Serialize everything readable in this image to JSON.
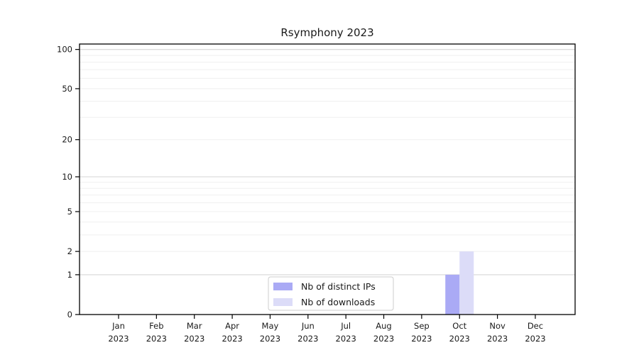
{
  "chart_data": {
    "type": "bar",
    "title": "Rsymphony 2023",
    "categories": [
      "Jan 2023",
      "Feb 2023",
      "Mar 2023",
      "Apr 2023",
      "May 2023",
      "Jun 2023",
      "Jul 2023",
      "Aug 2023",
      "Sep 2023",
      "Oct 2023",
      "Nov 2023",
      "Dec 2023"
    ],
    "series": [
      {
        "name": "Nb of distinct IPs",
        "color": "#aaaaf5",
        "values": [
          0,
          0,
          0,
          0,
          0,
          0,
          0,
          0,
          0,
          1,
          0,
          0
        ]
      },
      {
        "name": "Nb of downloads",
        "color": "#dcdcf8",
        "values": [
          0,
          0,
          0,
          0,
          0,
          0,
          0,
          0,
          0,
          2,
          0,
          0
        ]
      }
    ],
    "xlabel": "",
    "ylabel": "",
    "yscale": "log1p",
    "ytick_values": [
      0,
      1,
      2,
      5,
      10,
      20,
      50,
      100
    ],
    "ylim": [
      0,
      110
    ],
    "grid": {
      "show": true,
      "major_at": [
        1,
        10,
        100
      ],
      "minor_at": [
        2,
        3,
        4,
        5,
        6,
        7,
        8,
        9,
        20,
        30,
        40,
        50,
        60,
        70,
        80,
        90
      ]
    },
    "legend": {
      "position": "lower center",
      "entries": [
        "Nb of distinct IPs",
        "Nb of downloads"
      ]
    },
    "colors": {
      "background": "#ffffff",
      "axis": "#000000",
      "text": "#1a1a1a",
      "major_grid": "#d6d6d6",
      "minor_grid": "#efefef",
      "legend_border": "#cccccc",
      "legend_background": "#ffffff"
    }
  }
}
